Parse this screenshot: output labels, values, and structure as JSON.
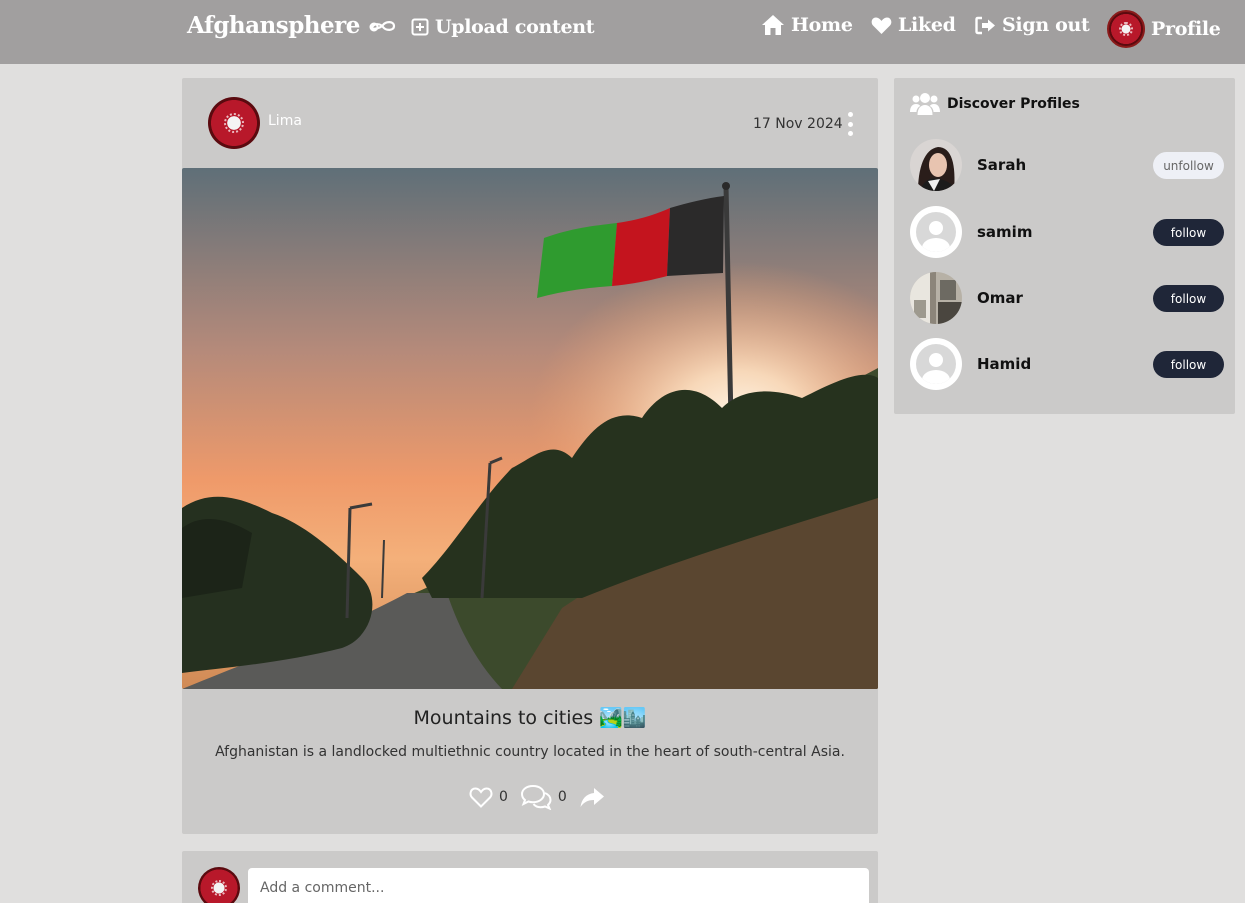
{
  "navbar": {
    "brand": "Afghansphere",
    "upload_label": "Upload content",
    "home_label": "Home",
    "liked_label": "Liked",
    "signout_label": "Sign out",
    "profile_label": "Profile"
  },
  "post": {
    "author": "Lima",
    "date": "17 Nov 2024",
    "title": "Mountains to cities 🏞️🏙️",
    "description": "Afghanistan is a landlocked multiethnic country located in the heart of south-central Asia.",
    "likes": "0",
    "comments": "0"
  },
  "comment_box": {
    "placeholder": "Add a comment..."
  },
  "discover": {
    "title": "Discover Profiles",
    "profiles": [
      {
        "name": "Sarah",
        "button": "unfollow"
      },
      {
        "name": "samim",
        "button": "follow"
      },
      {
        "name": "Omar",
        "button": "follow"
      },
      {
        "name": "Hamid",
        "button": "follow"
      }
    ]
  }
}
